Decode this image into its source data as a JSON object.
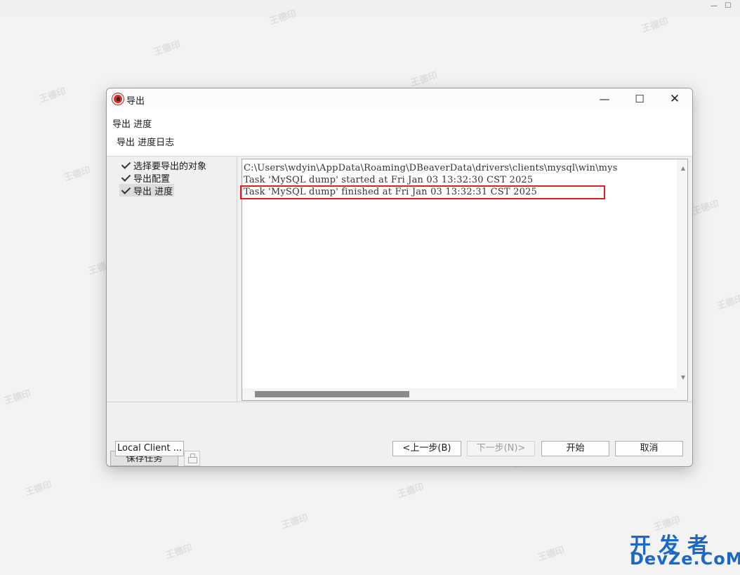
{
  "window": {
    "title": "导出",
    "minimize_glyph": "—",
    "maximize_glyph": "☐",
    "close_glyph": "✕"
  },
  "outer_window": {
    "minimize_glyph": "—",
    "maximize_glyph": "☐"
  },
  "header": {
    "title": "导出 进度",
    "description": "导出 进度日志"
  },
  "nav": {
    "items": [
      {
        "label": "选择要导出的对象",
        "checked": true,
        "selected": false
      },
      {
        "label": "导出配置",
        "checked": true,
        "selected": false
      },
      {
        "label": "导出 进度",
        "checked": true,
        "selected": true
      }
    ]
  },
  "log": {
    "lines": [
      "C:\\Users\\wdyin\\AppData\\Roaming\\DBeaverData\\drivers\\clients\\mysql\\win\\mys",
      "Task 'MySQL dump' started at Fri Jan 03 13:32:30 CST 2025",
      "Task 'MySQL dump' finished at Fri Jan 03 13:32:31 CST 2025"
    ],
    "highlight_color": "#e02020"
  },
  "buttons": {
    "save_task": "保存任务",
    "local_client": "Local Client ...",
    "back": "<上一步(B)",
    "next": "下一步(N)>",
    "start": "开始",
    "cancel": "取消"
  },
  "watermark_text": "王德印",
  "branding": {
    "cn": "开发者",
    "en": "DevZe.CoM",
    "color": "#1b68c6"
  }
}
